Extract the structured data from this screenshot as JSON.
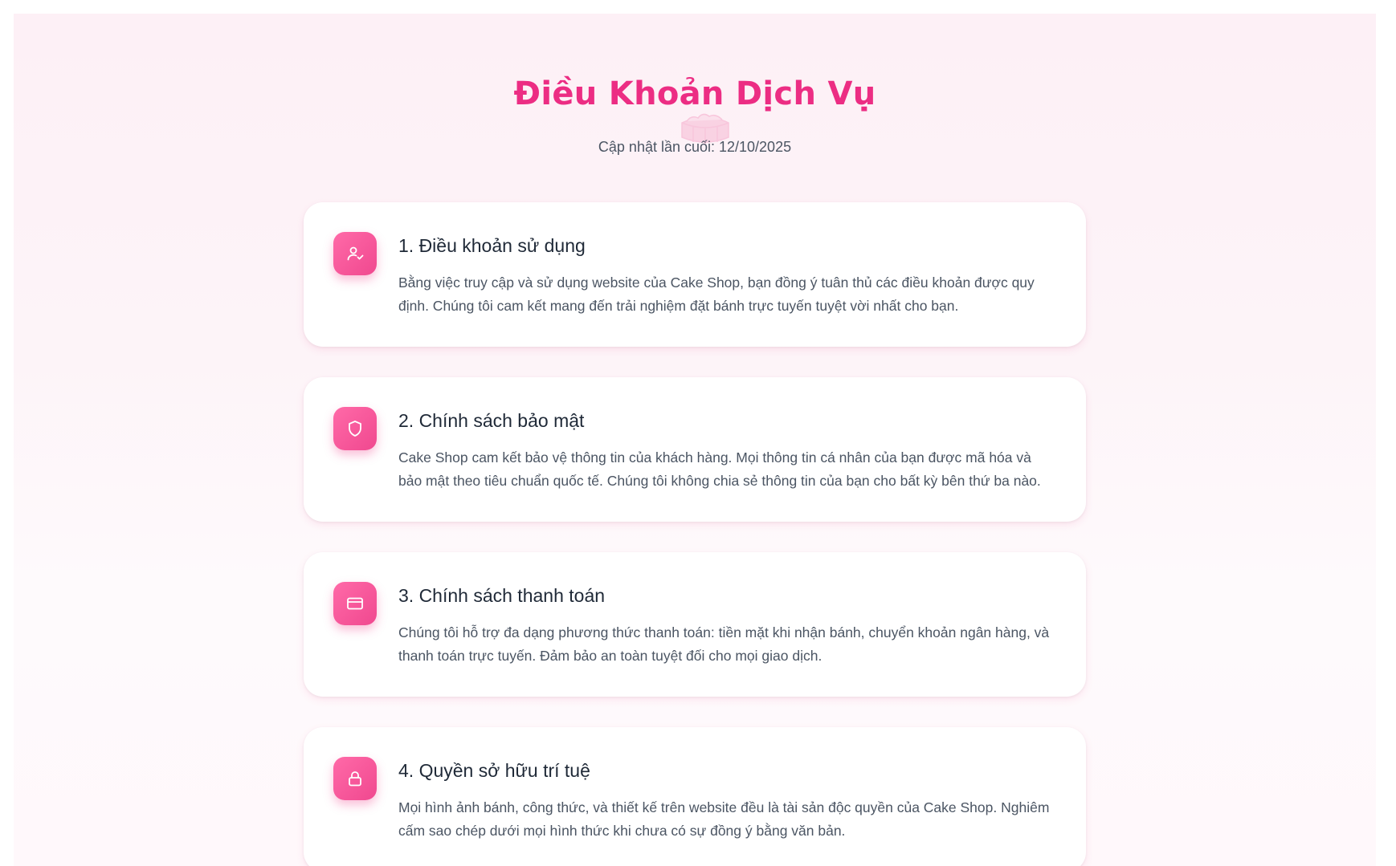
{
  "header": {
    "title": "Điều Khoản Dịch Vụ",
    "updated_label": "Cập nhật lần cuối: 12/10/2025",
    "accent_color": "#ec2d83"
  },
  "sections": [
    {
      "icon": "user-check-icon",
      "title": "1. Điều khoản sử dụng",
      "text": "Bằng việc truy cập và sử dụng website của Cake Shop, bạn đồng ý tuân thủ các điều khoản được quy định. Chúng tôi cam kết mang đến trải nghiệm đặt bánh trực tuyến tuyệt vời nhất cho bạn."
    },
    {
      "icon": "shield-icon",
      "title": "2. Chính sách bảo mật",
      "text": "Cake Shop cam kết bảo vệ thông tin của khách hàng. Mọi thông tin cá nhân của bạn được mã hóa và bảo mật theo tiêu chuẩn quốc tế. Chúng tôi không chia sẻ thông tin của bạn cho bất kỳ bên thứ ba nào."
    },
    {
      "icon": "credit-card-icon",
      "title": "3. Chính sách thanh toán",
      "text": "Chúng tôi hỗ trợ đa dạng phương thức thanh toán: tiền mặt khi nhận bánh, chuyển khoản ngân hàng, và thanh toán trực tuyến. Đảm bảo an toàn tuyệt đối cho mọi giao dịch."
    },
    {
      "icon": "lock-icon",
      "title": "4. Quyền sở hữu trí tuệ",
      "text": "Mọi hình ảnh bánh, công thức, và thiết kế trên website đều là tài sản độc quyền của Cake Shop. Nghiêm cấm sao chép dưới mọi hình thức khi chưa có sự đồng ý bằng văn bản."
    }
  ]
}
